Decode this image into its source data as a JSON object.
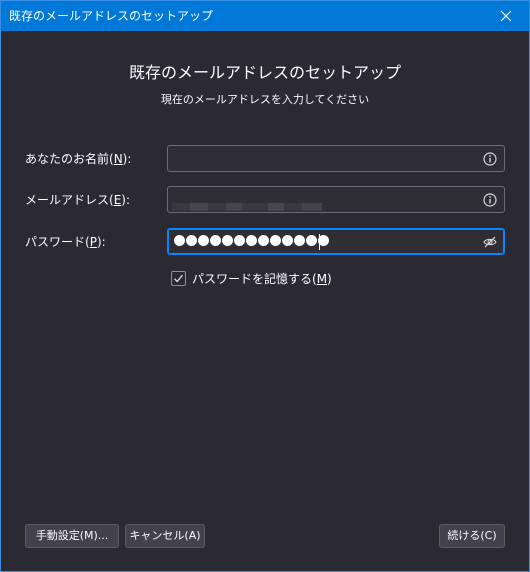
{
  "window": {
    "title": "既存のメールアドレスのセットアップ"
  },
  "header": {
    "heading": "既存のメールアドレスのセットアップ",
    "subheading": "現在のメールアドレスを入力してください"
  },
  "form": {
    "name": {
      "label_prefix": "あなたのお名前(",
      "access_key": "N",
      "label_suffix": "):",
      "value": "",
      "icon": "info-icon"
    },
    "email": {
      "label_prefix": "メールアドレス(",
      "access_key": "E",
      "label_suffix": "):",
      "value": "",
      "icon": "info-icon"
    },
    "password": {
      "label_prefix": "パスワード(",
      "access_key": "P",
      "label_suffix": "):",
      "masked_length": 13,
      "icon": "eye-slash-icon"
    },
    "remember": {
      "label_prefix": "パスワードを記憶する(",
      "access_key": "M",
      "label_suffix": ")",
      "checked": true
    }
  },
  "buttons": {
    "manual": "手動設定(M)...",
    "cancel": "キャンセル(A)",
    "continue": "続ける(C)"
  },
  "colors": {
    "titlebar": "#0078d7",
    "background": "#2b2a33",
    "focus_border": "#0a84ff",
    "text": "#fbfbfe"
  }
}
